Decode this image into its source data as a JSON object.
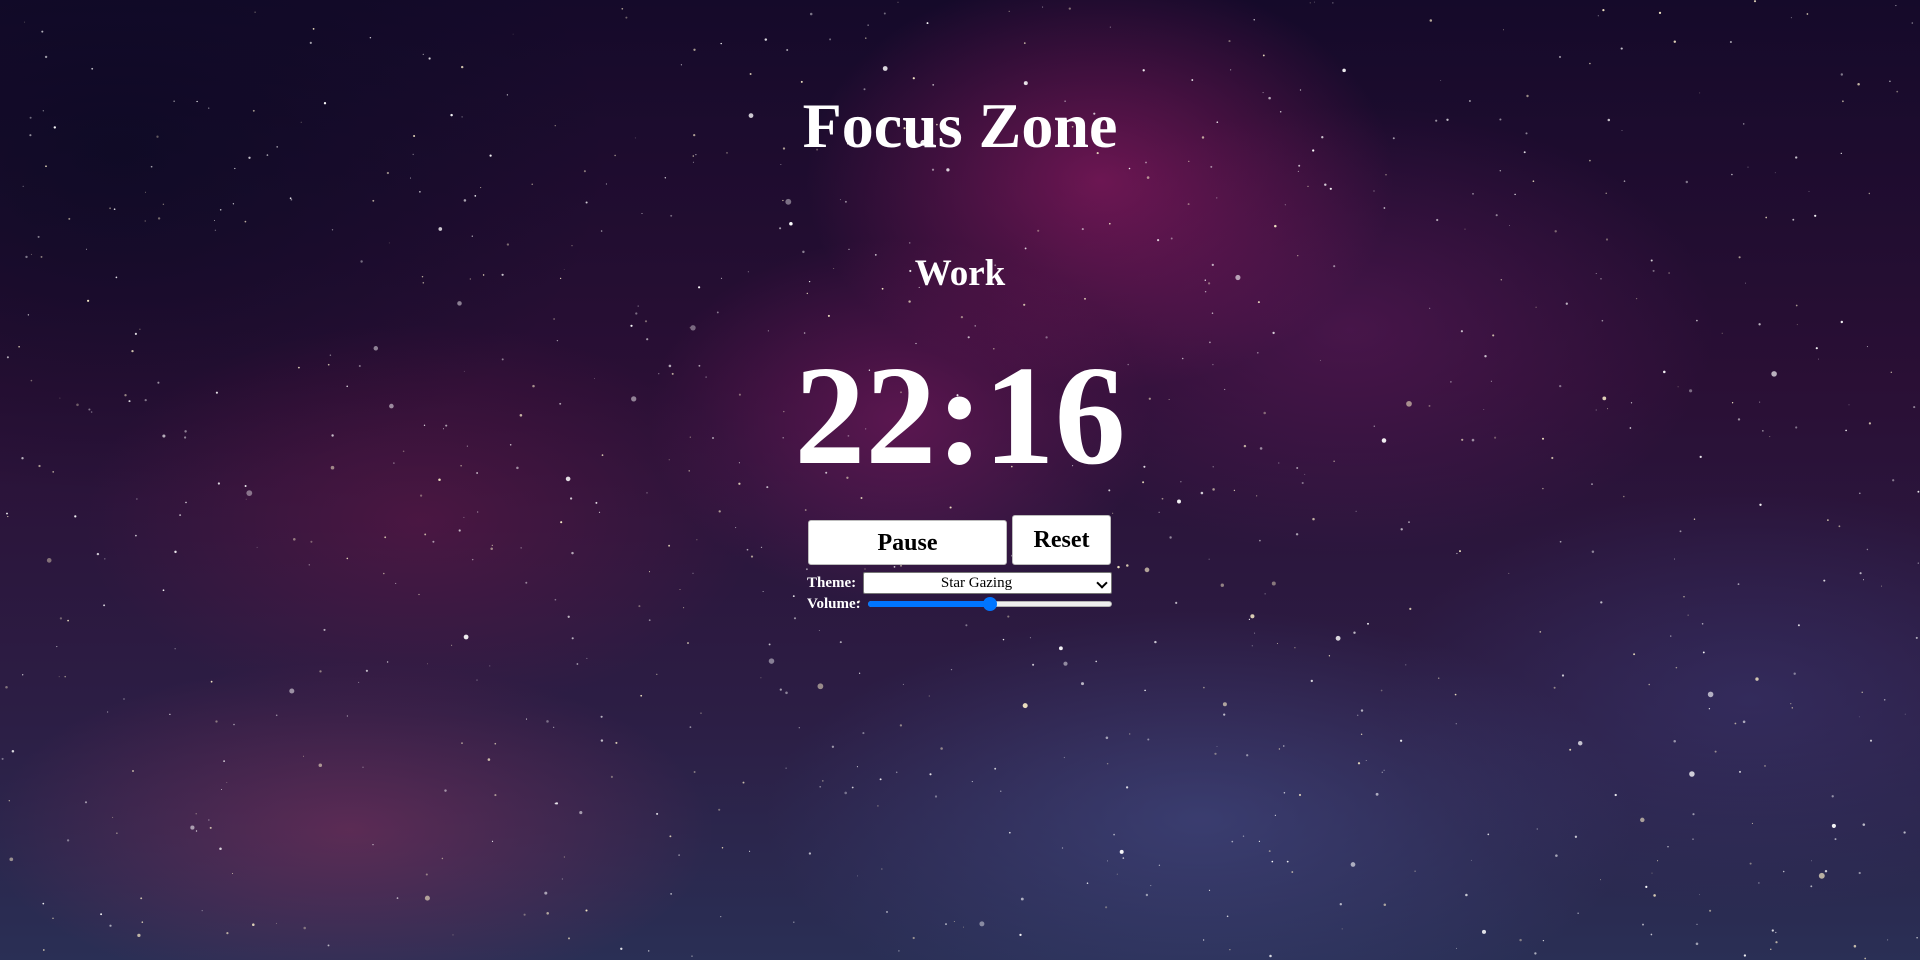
{
  "app": {
    "title": "Focus Zone"
  },
  "session": {
    "phase": "Work",
    "time_remaining": "22:16"
  },
  "controls": {
    "pause_label": "Pause",
    "reset_label": "Reset"
  },
  "settings": {
    "theme_label": "Theme:",
    "theme_value": "Star Gazing",
    "volume_label": "Volume:",
    "volume_value": 0.5
  },
  "colors": {
    "accent": "#0075ff",
    "text": "#ffffff",
    "button_bg": "#ffffff"
  },
  "icons": {
    "theme_select": "chevron-down-icon",
    "background": "starfield-nebula"
  }
}
